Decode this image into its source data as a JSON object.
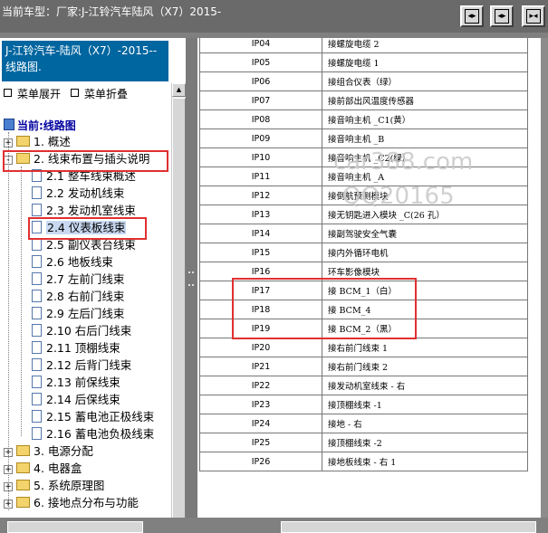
{
  "header": {
    "title": "当前车型：厂家:J-江铃汽车陆风（X7）2015-",
    "buttons": [
      {
        "name": "collapse-pane-button",
        "glyph": "◂▸"
      },
      {
        "name": "split-pane-button",
        "glyph": "◂▸"
      },
      {
        "name": "expand-pane-button",
        "glyph": "▸◂"
      }
    ]
  },
  "sidebar": {
    "doc_title": "J-江铃汽车-陆风（X7）-2015-- 线路图.",
    "expand_all": "菜单展开",
    "collapse_all": "菜单折叠",
    "current": "当前:线路图",
    "tree": [
      {
        "label": "1. 概述",
        "type": "folder",
        "expander": "+"
      },
      {
        "label": "2. 线束布置与插头说明",
        "type": "folder",
        "expander": "-"
      },
      {
        "label": "2.1 整车线束概述",
        "type": "page"
      },
      {
        "label": "2.2 发动机线束",
        "type": "page"
      },
      {
        "label": "2.3 发动机室线束",
        "type": "page"
      },
      {
        "label": "2.4 仪表板线束",
        "type": "page",
        "selected": true
      },
      {
        "label": "2.5 副仪表台线束",
        "type": "page"
      },
      {
        "label": "2.6 地板线束",
        "type": "page"
      },
      {
        "label": "2.7 左前门线束",
        "type": "page"
      },
      {
        "label": "2.8 右前门线束",
        "type": "page"
      },
      {
        "label": "2.9 左后门线束",
        "type": "page"
      },
      {
        "label": "2.10 右后门线束",
        "type": "page"
      },
      {
        "label": "2.11 顶棚线束",
        "type": "page"
      },
      {
        "label": "2.12 后背门线束",
        "type": "page"
      },
      {
        "label": "2.13 前保线束",
        "type": "page"
      },
      {
        "label": "2.14 后保线束",
        "type": "page"
      },
      {
        "label": "2.15 蓄电池正极线束",
        "type": "page"
      },
      {
        "label": "2.16 蓄电池负极线束",
        "type": "page"
      },
      {
        "label": "3. 电源分配",
        "type": "folder",
        "expander": "+"
      },
      {
        "label": "4. 电器盒",
        "type": "folder",
        "expander": "+"
      },
      {
        "label": "5. 系统原理图",
        "type": "folder",
        "expander": "+"
      },
      {
        "label": "6. 接地点分布与功能",
        "type": "folder",
        "expander": "+"
      }
    ]
  },
  "table": {
    "rows": [
      [
        "IP04",
        "接螺旋电缆 2"
      ],
      [
        "IP05",
        "接螺旋电缆 1"
      ],
      [
        "IP06",
        "接组合仪表（绿）"
      ],
      [
        "IP07",
        "接前部出风温度传感器"
      ],
      [
        "IP08",
        "接音响主机 _C1(黄）"
      ],
      [
        "IP09",
        "接音响主机 _B"
      ],
      [
        "IP10",
        "接音响主机 _C2(绿）"
      ],
      [
        "IP11",
        "接音响主机 _A"
      ],
      [
        "IP12",
        "接倒航预测模块"
      ],
      [
        "IP13",
        "接无钥匙进入模块 _C(26 孔）"
      ],
      [
        "IP14",
        "接副驾驶安全气囊"
      ],
      [
        "IP15",
        "接内外循环电机"
      ],
      [
        "IP16",
        "环车影像模块"
      ],
      [
        "IP17",
        "接 BCM_1（白）"
      ],
      [
        "IP18",
        "接 BCM_4"
      ],
      [
        "IP19",
        "接 BCM_2（黑）"
      ],
      [
        "IP20",
        "接右前门线束 1"
      ],
      [
        "IP21",
        "接右前门线束 2"
      ],
      [
        "IP22",
        "接发动机室线束 - 右"
      ],
      [
        "IP23",
        "接顶棚线束 -1"
      ],
      [
        "IP24",
        "接地 - 右"
      ],
      [
        "IP25",
        "接顶棚线束 -2"
      ],
      [
        "IP26",
        "接地板线束 - 右 1"
      ]
    ]
  },
  "watermark": {
    "line1": "car388.com",
    "line2": "QQ20165"
  },
  "colors": {
    "title_bg": "#0066a0",
    "highlight": "#e03030",
    "selection": "#c8d8f0"
  }
}
